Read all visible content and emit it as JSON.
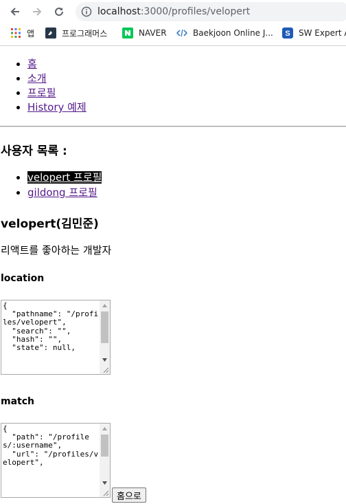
{
  "browser": {
    "url_host": "localhost",
    "url_path": ":3000/profiles/velopert",
    "bookmarks": [
      {
        "label": "앱",
        "icon": "apps-grid-icon"
      },
      {
        "label": "프로그래머스",
        "icon": "programmers-icon"
      },
      {
        "label": "NAVER",
        "icon": "naver-icon"
      },
      {
        "label": "Baekjoon Online J...",
        "icon": "code-brackets-icon"
      },
      {
        "label": "SW Expert A",
        "icon": "sw-expert-icon"
      }
    ]
  },
  "nav": {
    "items": [
      {
        "label": "홈"
      },
      {
        "label": "소개"
      },
      {
        "label": "프로필"
      },
      {
        "label": "History 예제"
      }
    ]
  },
  "users": {
    "heading": "사용자 목록 :",
    "items": [
      {
        "label": "velopert 프로필",
        "active": true
      },
      {
        "label": "gildong 프로필",
        "active": false
      }
    ]
  },
  "profile": {
    "name": "velopert(김민준)",
    "description": "리액트를 좋아하는 개발자"
  },
  "location": {
    "heading": "location",
    "text": "{\n  \"pathname\": \"/profiles/velopert\",\n  \"search\": \"\",\n  \"hash\": \"\",\n  \"state\": null,"
  },
  "match": {
    "heading": "match",
    "text": "{\n  \"path\": \"/profiles/:username\",\n  \"url\": \"/profiles/velopert\","
  },
  "home_button": "홈으로",
  "colors": {
    "link": "#551a8b",
    "active_bg": "#000000",
    "active_text": "#ffffff"
  }
}
